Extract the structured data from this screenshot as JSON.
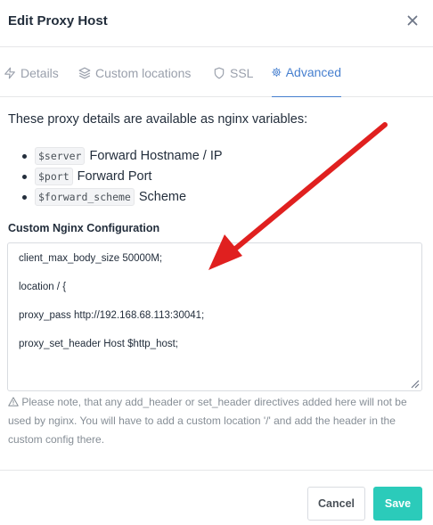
{
  "modal": {
    "title": "Edit Proxy Host",
    "close_icon": "close-icon"
  },
  "tabs": [
    {
      "label": "Details",
      "icon": "zap-icon",
      "active": false
    },
    {
      "label": "Custom locations",
      "icon": "layers-icon",
      "active": false
    },
    {
      "label": "SSL",
      "icon": "shield-icon",
      "active": false
    },
    {
      "label": "Advanced",
      "icon": "settings-icon",
      "active": true
    }
  ],
  "advanced": {
    "intro": "These proxy details are available as nginx variables:",
    "variables": [
      {
        "code": "$server",
        "desc": "Forward Hostname / IP"
      },
      {
        "code": "$port",
        "desc": "Forward Port"
      },
      {
        "code": "$forward_scheme",
        "desc": "Scheme"
      }
    ],
    "config_label": "Custom Nginx Configuration",
    "config_lines": [
      "client_max_body_size 50000M;",
      "",
      "location / {",
      "",
      "proxy_pass http://192.168.68.113:30041;",
      "",
      "proxy_set_header Host $http_host;"
    ],
    "note": "Please note, that any add_header or set_header directives added here will not be used by nginx. You will have to add a custom location '/' and add the header in the custom config there."
  },
  "footer": {
    "cancel_label": "Cancel",
    "save_label": "Save"
  },
  "colors": {
    "accent": "#467fcf",
    "save": "#2bcbba",
    "annotation_arrow": "#e0201f"
  }
}
